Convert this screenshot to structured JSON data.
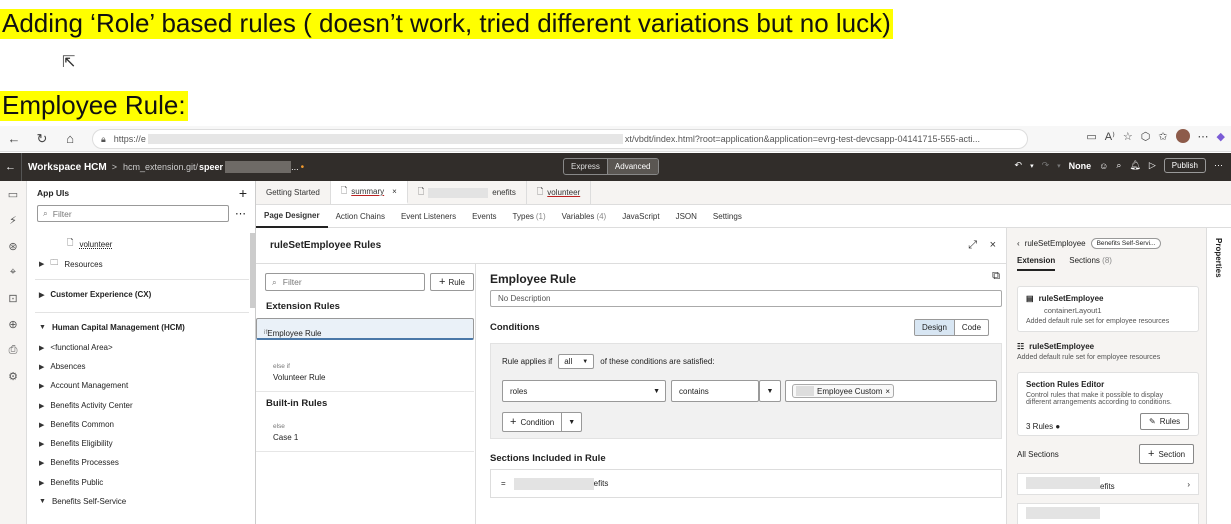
{
  "annotations": {
    "heading1": "Adding ‘Role’ based rules ( doesn’t work, tried different variations but no luck)",
    "heading2": "Employee Rule:"
  },
  "browser": {
    "url_prefix": "https://",
    "url_start": "e",
    "url_suffix": "xt/vbdt/index.html?root=application&application=evrg-test-devcsapp-04141715-555-acti...",
    "reader_label": "A⁾"
  },
  "app_header": {
    "workspace": "Workspace HCM",
    "separator": ">",
    "path": "hcm_extension.git/",
    "path_bold": "speer",
    "ellipsis": "...",
    "modes": [
      "Express",
      "Advanced"
    ],
    "active_mode": "Advanced",
    "profile": "None",
    "publish_label": "Publish"
  },
  "left_panel": {
    "title": "App UIs",
    "filter_placeholder": "Filter",
    "tree": [
      {
        "label": "volunteer",
        "kind": "page"
      },
      {
        "label": "Resources",
        "kind": "folder"
      },
      {
        "label": "Customer Experience (CX)",
        "kind": "group"
      },
      {
        "label": "Human Capital Management (HCM)",
        "kind": "group-open"
      },
      {
        "label": "<functional Area>",
        "kind": "item"
      },
      {
        "label": "Absences",
        "kind": "item"
      },
      {
        "label": "Account Management",
        "kind": "item"
      },
      {
        "label": "Benefits Activity Center",
        "kind": "item"
      },
      {
        "label": "Benefits Common",
        "kind": "item"
      },
      {
        "label": "Benefits Eligibility",
        "kind": "item"
      },
      {
        "label": "Benefits Processes",
        "kind": "item"
      },
      {
        "label": "Benefits Public",
        "kind": "item"
      },
      {
        "label": "Benefits Self-Service",
        "kind": "item-open"
      }
    ]
  },
  "tabs": [
    {
      "label": "Getting Started"
    },
    {
      "label": "summary",
      "active": true
    },
    {
      "label": "enefits"
    },
    {
      "label": "volunteer"
    }
  ],
  "subtabs": [
    {
      "label": "Page Designer",
      "active": true
    },
    {
      "label": "Action Chains"
    },
    {
      "label": "Event Listeners"
    },
    {
      "label": "Events"
    },
    {
      "label": "Types",
      "count": "(1)"
    },
    {
      "label": "Variables",
      "count": "(4)"
    },
    {
      "label": "JavaScript"
    },
    {
      "label": "JSON"
    },
    {
      "label": "Settings"
    }
  ],
  "editor": {
    "title": "ruleSetEmployee Rules",
    "filter_placeholder": "Filter",
    "add_rule_label": "Rule",
    "extension_rules_heading": "Extension Rules",
    "extension_rules": [
      {
        "keyword": "if",
        "name": "Employee Rule",
        "selected": true
      },
      {
        "keyword": "else if",
        "name": "Volunteer Rule"
      }
    ],
    "builtin_heading": "Built-in Rules",
    "builtin_rules": [
      {
        "keyword": "else",
        "name": "Case 1"
      }
    ]
  },
  "rule_detail": {
    "name": "Employee Rule",
    "description": "No Description",
    "conditions_heading": "Conditions",
    "view_modes": [
      "Design",
      "Code"
    ],
    "active_view": "Design",
    "applies_prefix": "Rule applies if",
    "applies_value": "all",
    "applies_suffix": "of these conditions are satisfied:",
    "condition": {
      "field": "roles",
      "operator": "contains",
      "value_chip": "Employee Custom"
    },
    "add_condition_label": "Condition",
    "sections_heading": "Sections Included in Rule",
    "section_row_marker": "=",
    "section_row_suffix": "efits"
  },
  "properties": {
    "crumb_name": "ruleSetEmployee",
    "crumb_badge": "Benefits Self-Servi...",
    "tabs": [
      {
        "label": "Extension",
        "active": true
      },
      {
        "label": "Sections",
        "count": "(8)"
      }
    ],
    "card": {
      "name": "ruleSetEmployee",
      "sub": "containerLayout1",
      "desc": "Added default rule set for employee resources"
    },
    "block": {
      "name": "ruleSetEmployee",
      "desc": "Added default rule set for employee resources"
    },
    "section_rules_editor": {
      "title": "Section Rules Editor",
      "desc": "Control rules that make it possible to display different arrangements according to conditions.",
      "count": "3 Rules",
      "button": "Rules"
    },
    "all_sections_label": "All Sections",
    "add_section_label": "Section",
    "section_item_suffix": "efits",
    "vertical_tab": "Properties"
  }
}
